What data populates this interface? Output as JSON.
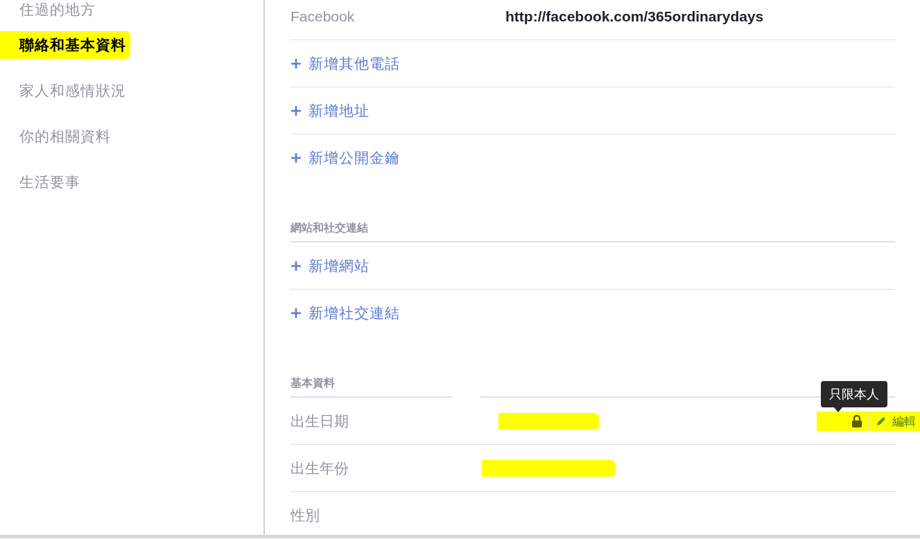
{
  "sidebar": {
    "items": [
      {
        "label": "住過的地方",
        "selected": false
      },
      {
        "label": "聯絡和基本資料",
        "selected": true
      },
      {
        "label": "家人和感情狀況",
        "selected": false
      },
      {
        "label": "你的相關資料",
        "selected": false
      },
      {
        "label": "生活要事",
        "selected": false
      }
    ]
  },
  "contact": {
    "rows": [
      {
        "kind": "field",
        "label": "Facebook",
        "value": "http://facebook.com/365ordinarydays"
      },
      {
        "kind": "add",
        "label": "新增其他電話"
      },
      {
        "kind": "add",
        "label": "新增地址"
      },
      {
        "kind": "add",
        "label": "新增公開金鑰"
      }
    ]
  },
  "sections": [
    {
      "title": "網站和社交連結",
      "rows": [
        {
          "kind": "add",
          "label": "新增網站"
        },
        {
          "kind": "add",
          "label": "新增社交連結"
        }
      ]
    },
    {
      "title": "基本資料",
      "rows": [
        {
          "kind": "field",
          "label": "出生日期",
          "redacted": true,
          "privacy_tooltip": "只限本人",
          "edit_label": "編輯"
        },
        {
          "kind": "field",
          "label": "出生年份",
          "redacted": true
        },
        {
          "kind": "field",
          "label": "性別",
          "redacted": false
        }
      ]
    }
  ]
}
